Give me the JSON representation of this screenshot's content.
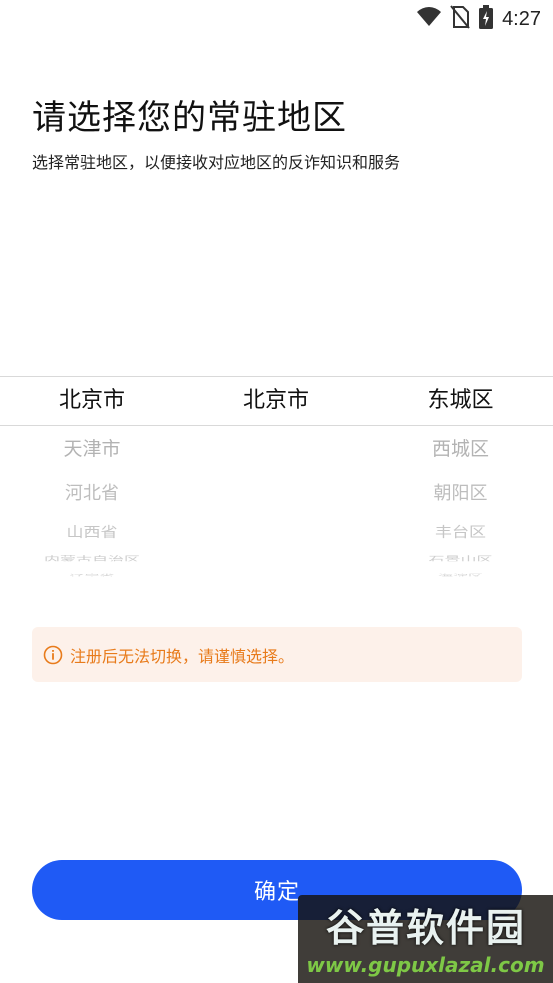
{
  "status_bar": {
    "time": "4:27",
    "icons": [
      "wifi-icon",
      "no-sim-icon",
      "battery-charging-icon"
    ]
  },
  "header": {
    "title": "请选择您的常驻地区",
    "subtitle": "选择常驻地区，以便接收对应地区的反诈知识和服务"
  },
  "picker": {
    "province": {
      "selected": "北京市",
      "options": [
        "天津市",
        "河北省",
        "山西省",
        "内蒙古自治区",
        "辽宁省"
      ]
    },
    "city": {
      "selected": "北京市",
      "options": []
    },
    "district": {
      "selected": "东城区",
      "options": [
        "西城区",
        "朝阳区",
        "丰台区",
        "石景山区",
        "海淀区"
      ]
    }
  },
  "notice": {
    "icon": "info-icon",
    "text": "注册后无法切换，请谨慎选择。",
    "color": "#e87b1b",
    "background": "#fdf1ea"
  },
  "confirm": {
    "label": "确定",
    "color": "#1f5af5"
  },
  "watermark": {
    "title": "谷普软件园",
    "url": "www.gupuxlazal.com"
  }
}
